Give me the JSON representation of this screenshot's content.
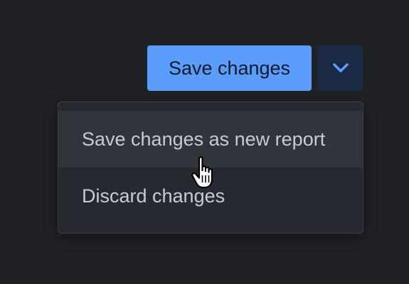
{
  "split_button": {
    "primary_label": "Save changes",
    "toggle_icon": "chevron-down-icon"
  },
  "menu": {
    "items": [
      {
        "label": "Save changes as new report",
        "hovered": true
      },
      {
        "label": "Discard changes",
        "hovered": false
      }
    ]
  },
  "cursor": {
    "icon": "hand-pointer-icon"
  },
  "colors": {
    "background": "#1f2125",
    "primary_button": "#5b9dfa",
    "primary_button_text": "#0f1a2c",
    "toggle_button": "#1b2a44",
    "chevron": "#5b9dfa",
    "menu_background": "#262a30",
    "menu_hover": "#30353c",
    "menu_border": "#3b4049",
    "menu_text": "#c7ccd3"
  }
}
